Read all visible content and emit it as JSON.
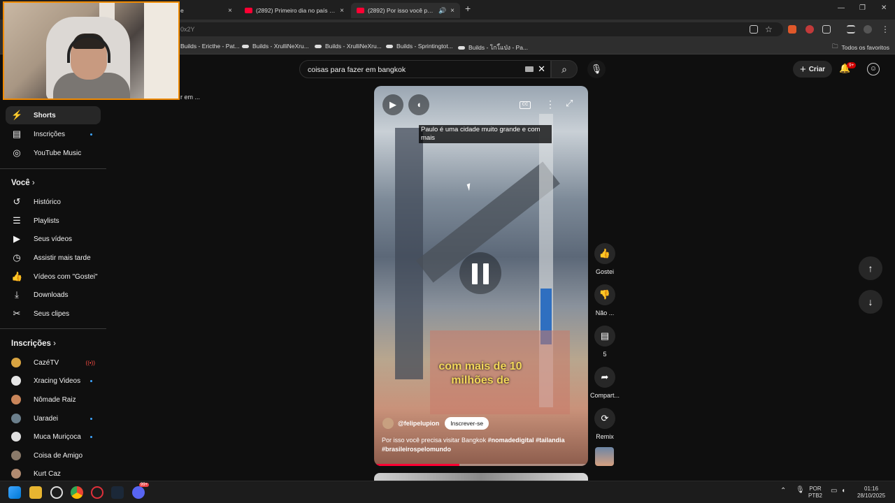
{
  "browser": {
    "tabs": [
      {
        "title": "e"
      },
      {
        "title": "(2892) Primeiro dia no país mais"
      },
      {
        "title": "(2892) Por isso você precisa"
      }
    ],
    "new_tab": "+",
    "close": "×",
    "window_controls": {
      "minimize": "—",
      "restore": "❐",
      "close": "✕"
    },
    "url_fragment": "0x2Y",
    "bookmarks": [
      "Builds - Ericthe - Pat...",
      "Builds - XrulliNeXru...",
      "Builds - XrulliNeXru...",
      "Builds - Sprintingtot...",
      "Builds - โกโ้แป่ง - Pa..."
    ],
    "all_bookmarks": "Todos os favoritos"
  },
  "youtube": {
    "search_query": "coisas para fazer em bangkok",
    "create_label": "Criar",
    "notification_count": "9+",
    "partial_text": "r em ..."
  },
  "sidebar": {
    "items_top": [
      {
        "label": "Shorts",
        "icon": "shorts-icon"
      },
      {
        "label": "Inscrições",
        "icon": "subscriptions-icon"
      },
      {
        "label": "YouTube Music",
        "icon": "music-icon"
      }
    ],
    "you_heading": "Você",
    "you_items": [
      {
        "label": "Histórico",
        "icon": "history-icon"
      },
      {
        "label": "Playlists",
        "icon": "playlist-icon"
      },
      {
        "label": "Seus vídeos",
        "icon": "video-icon"
      },
      {
        "label": "Assistir mais tarde",
        "icon": "clock-icon"
      },
      {
        "label": "Vídeos com \"Gostei\"",
        "icon": "like-icon"
      },
      {
        "label": "Downloads",
        "icon": "download-icon"
      },
      {
        "label": "Seus clipes",
        "icon": "scissors-icon"
      }
    ],
    "subs_heading": "Inscrições",
    "subscriptions": [
      {
        "label": "CazéTV",
        "color": "#d9a441"
      },
      {
        "label": "Xracing Videos",
        "color": "#e6e6e6"
      },
      {
        "label": "Nômade Raiz",
        "color": "#c9855a"
      },
      {
        "label": "Uaradei",
        "color": "#6b7f8c"
      },
      {
        "label": "Muca Muriçoca",
        "color": "#e0e0e0"
      },
      {
        "label": "Coisa de Amigo",
        "color": "#8a7a6a"
      },
      {
        "label": "Kurt Caz",
        "color": "#b08a70"
      }
    ]
  },
  "short": {
    "caption_box": "Paulo é uma cidade muito grande e com mais",
    "burned_caption": "com mais de 10 milhões de",
    "channel": "@felipelupion",
    "subscribe": "Inscrever-se",
    "description_plain": "Por isso você precisa visitar Bangkok ",
    "description_tags": "#nomadedigital #tailandia #brasileirospelomundo",
    "progress_fraction": 0.4
  },
  "actions": {
    "like": "Gostei",
    "dislike": "Não ...",
    "comments": "5",
    "share": "Compart...",
    "remix": "Remix"
  },
  "taskbar": {
    "lang_top": "POR",
    "lang_bottom": "PTB2",
    "time": "01:16",
    "date": "28/10/2025",
    "discord_badge": "99+"
  }
}
